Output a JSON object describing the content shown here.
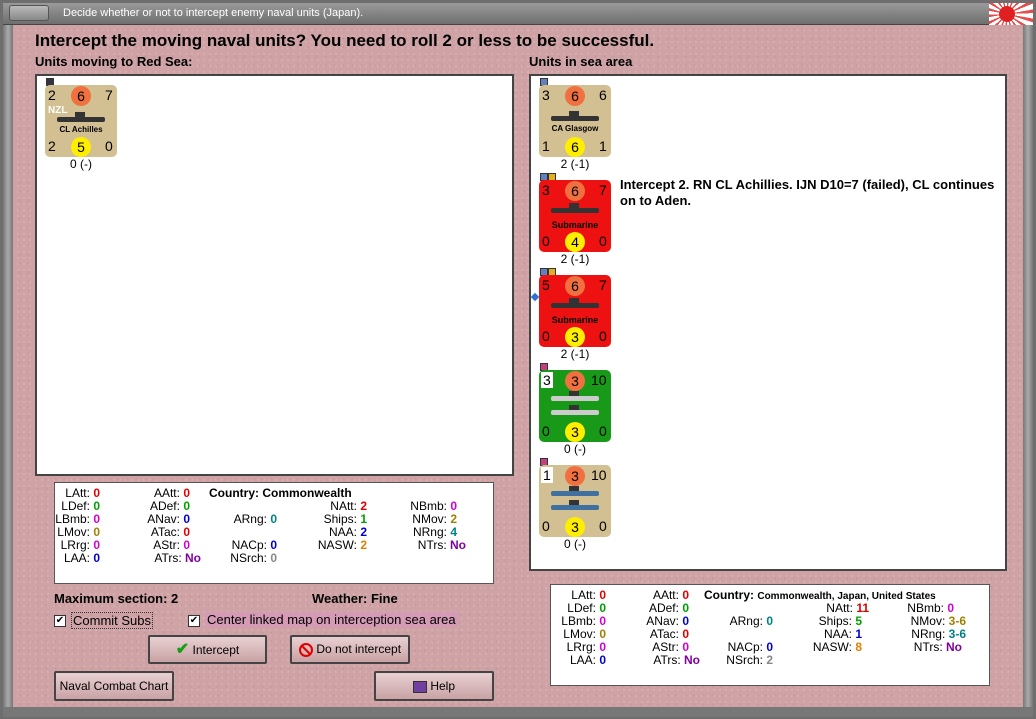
{
  "window": {
    "title": "Decide whether or not to intercept enemy naval units (Japan)."
  },
  "heading": "Intercept the moving naval units?  You need to roll 2 or less to be successful.",
  "left_panel": {
    "label": "Units moving to Red Sea:",
    "unit": {
      "tl": "2",
      "tc": "6",
      "tr": "7",
      "tag": "NZL",
      "name": "CL Achilles",
      "bl": "2",
      "bc": "5",
      "br": "0",
      "under": "0 (-)"
    }
  },
  "right_panel": {
    "label": "Units in sea area",
    "units": [
      {
        "tl": "3",
        "tc": "6",
        "tr": "6",
        "name": "CA Glasgow",
        "bl": "1",
        "bc": "6",
        "br": "1",
        "under": "2 (-1)"
      },
      {
        "tl": "3",
        "tc": "6",
        "tr": "7",
        "name": "Submarine",
        "bl": "0",
        "bc": "4",
        "br": "0",
        "under": "2 (-1)"
      },
      {
        "tl": "5",
        "tc": "6",
        "tr": "7",
        "name": "Submarine",
        "bl": "0",
        "bc": "3",
        "br": "0",
        "under": "2 (-1)"
      },
      {
        "tl": "3",
        "tc": "3",
        "tr": "10",
        "name": "",
        "bl": "0",
        "bc": "3",
        "br": "0",
        "under": "0 (-)"
      },
      {
        "tl": "1",
        "tc": "3",
        "tr": "10",
        "name": "",
        "bl": "0",
        "bc": "3",
        "br": "0",
        "under": "0 (-)"
      }
    ],
    "info": "Intercept 2.  RN CL Achillies.  IJN D10=7 (failed), CL continues on to Aden."
  },
  "left_stats": {
    "country_label": "Country:",
    "country": "Commonwealth",
    "LAtt": "0",
    "LDef": "0",
    "LBmb": "0",
    "LMov": "0",
    "LRrg": "0",
    "LAA": "0",
    "AAtt": "0",
    "ADef": "0",
    "ANav": "0",
    "ATac": "0",
    "AStr": "0",
    "ATrs": "No",
    "ARng": "0",
    "NACp": "0",
    "NSrch": "0",
    "NAtt": "2",
    "Ships": "1",
    "NAA": "2",
    "NASW": "2",
    "NBmb": "0",
    "NMov": "2",
    "NRng": "4",
    "NTrs": "No"
  },
  "right_stats": {
    "country_label": "Country:",
    "country": "Commonwealth, Japan, United States",
    "LAtt": "0",
    "LDef": "0",
    "LBmb": "0",
    "LMov": "0",
    "LRrg": "0",
    "LAA": "0",
    "AAtt": "0",
    "ADef": "0",
    "ANav": "0",
    "ATac": "0",
    "AStr": "0",
    "ATrs": "No",
    "ARng": "0",
    "NACp": "0",
    "NSrch": "2",
    "NAtt": "11",
    "Ships": "5",
    "NAA": "1",
    "NASW": "8",
    "NBmb": "0",
    "NMov": "3-6",
    "NRng": "3-6",
    "NTrs": "No"
  },
  "info_line": {
    "max_section": "Maximum section: 2",
    "weather": "Weather:  Fine"
  },
  "checkboxes": {
    "commit_subs": "Commit Subs",
    "center_map": "Center linked map on interception sea area"
  },
  "buttons": {
    "intercept": "Intercept",
    "no_intercept": "Do not intercept",
    "naval_chart": "Naval Combat Chart",
    "help": "Help"
  }
}
